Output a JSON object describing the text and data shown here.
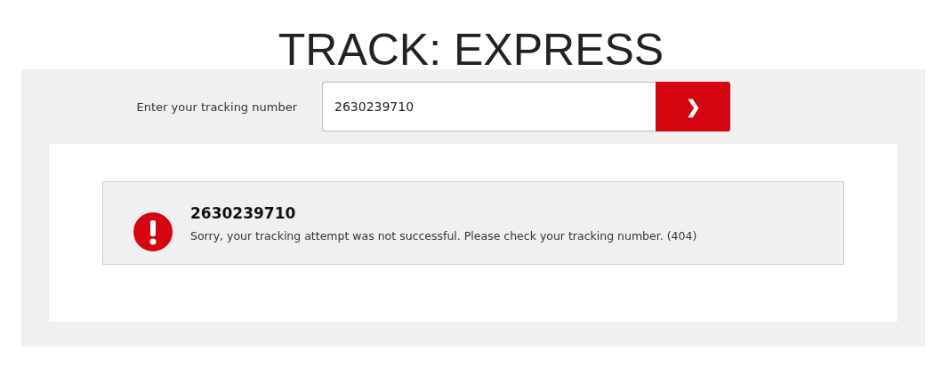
{
  "title": "TRACK: EXPRESS",
  "form": {
    "label": "Enter your tracking number",
    "value": "2630239710",
    "submit": "❯"
  },
  "message": {
    "kind": "error",
    "heading": "2630239710",
    "text": "Sorry, your tracking attempt was not successful. Please check your tracking number. (404)"
  }
}
